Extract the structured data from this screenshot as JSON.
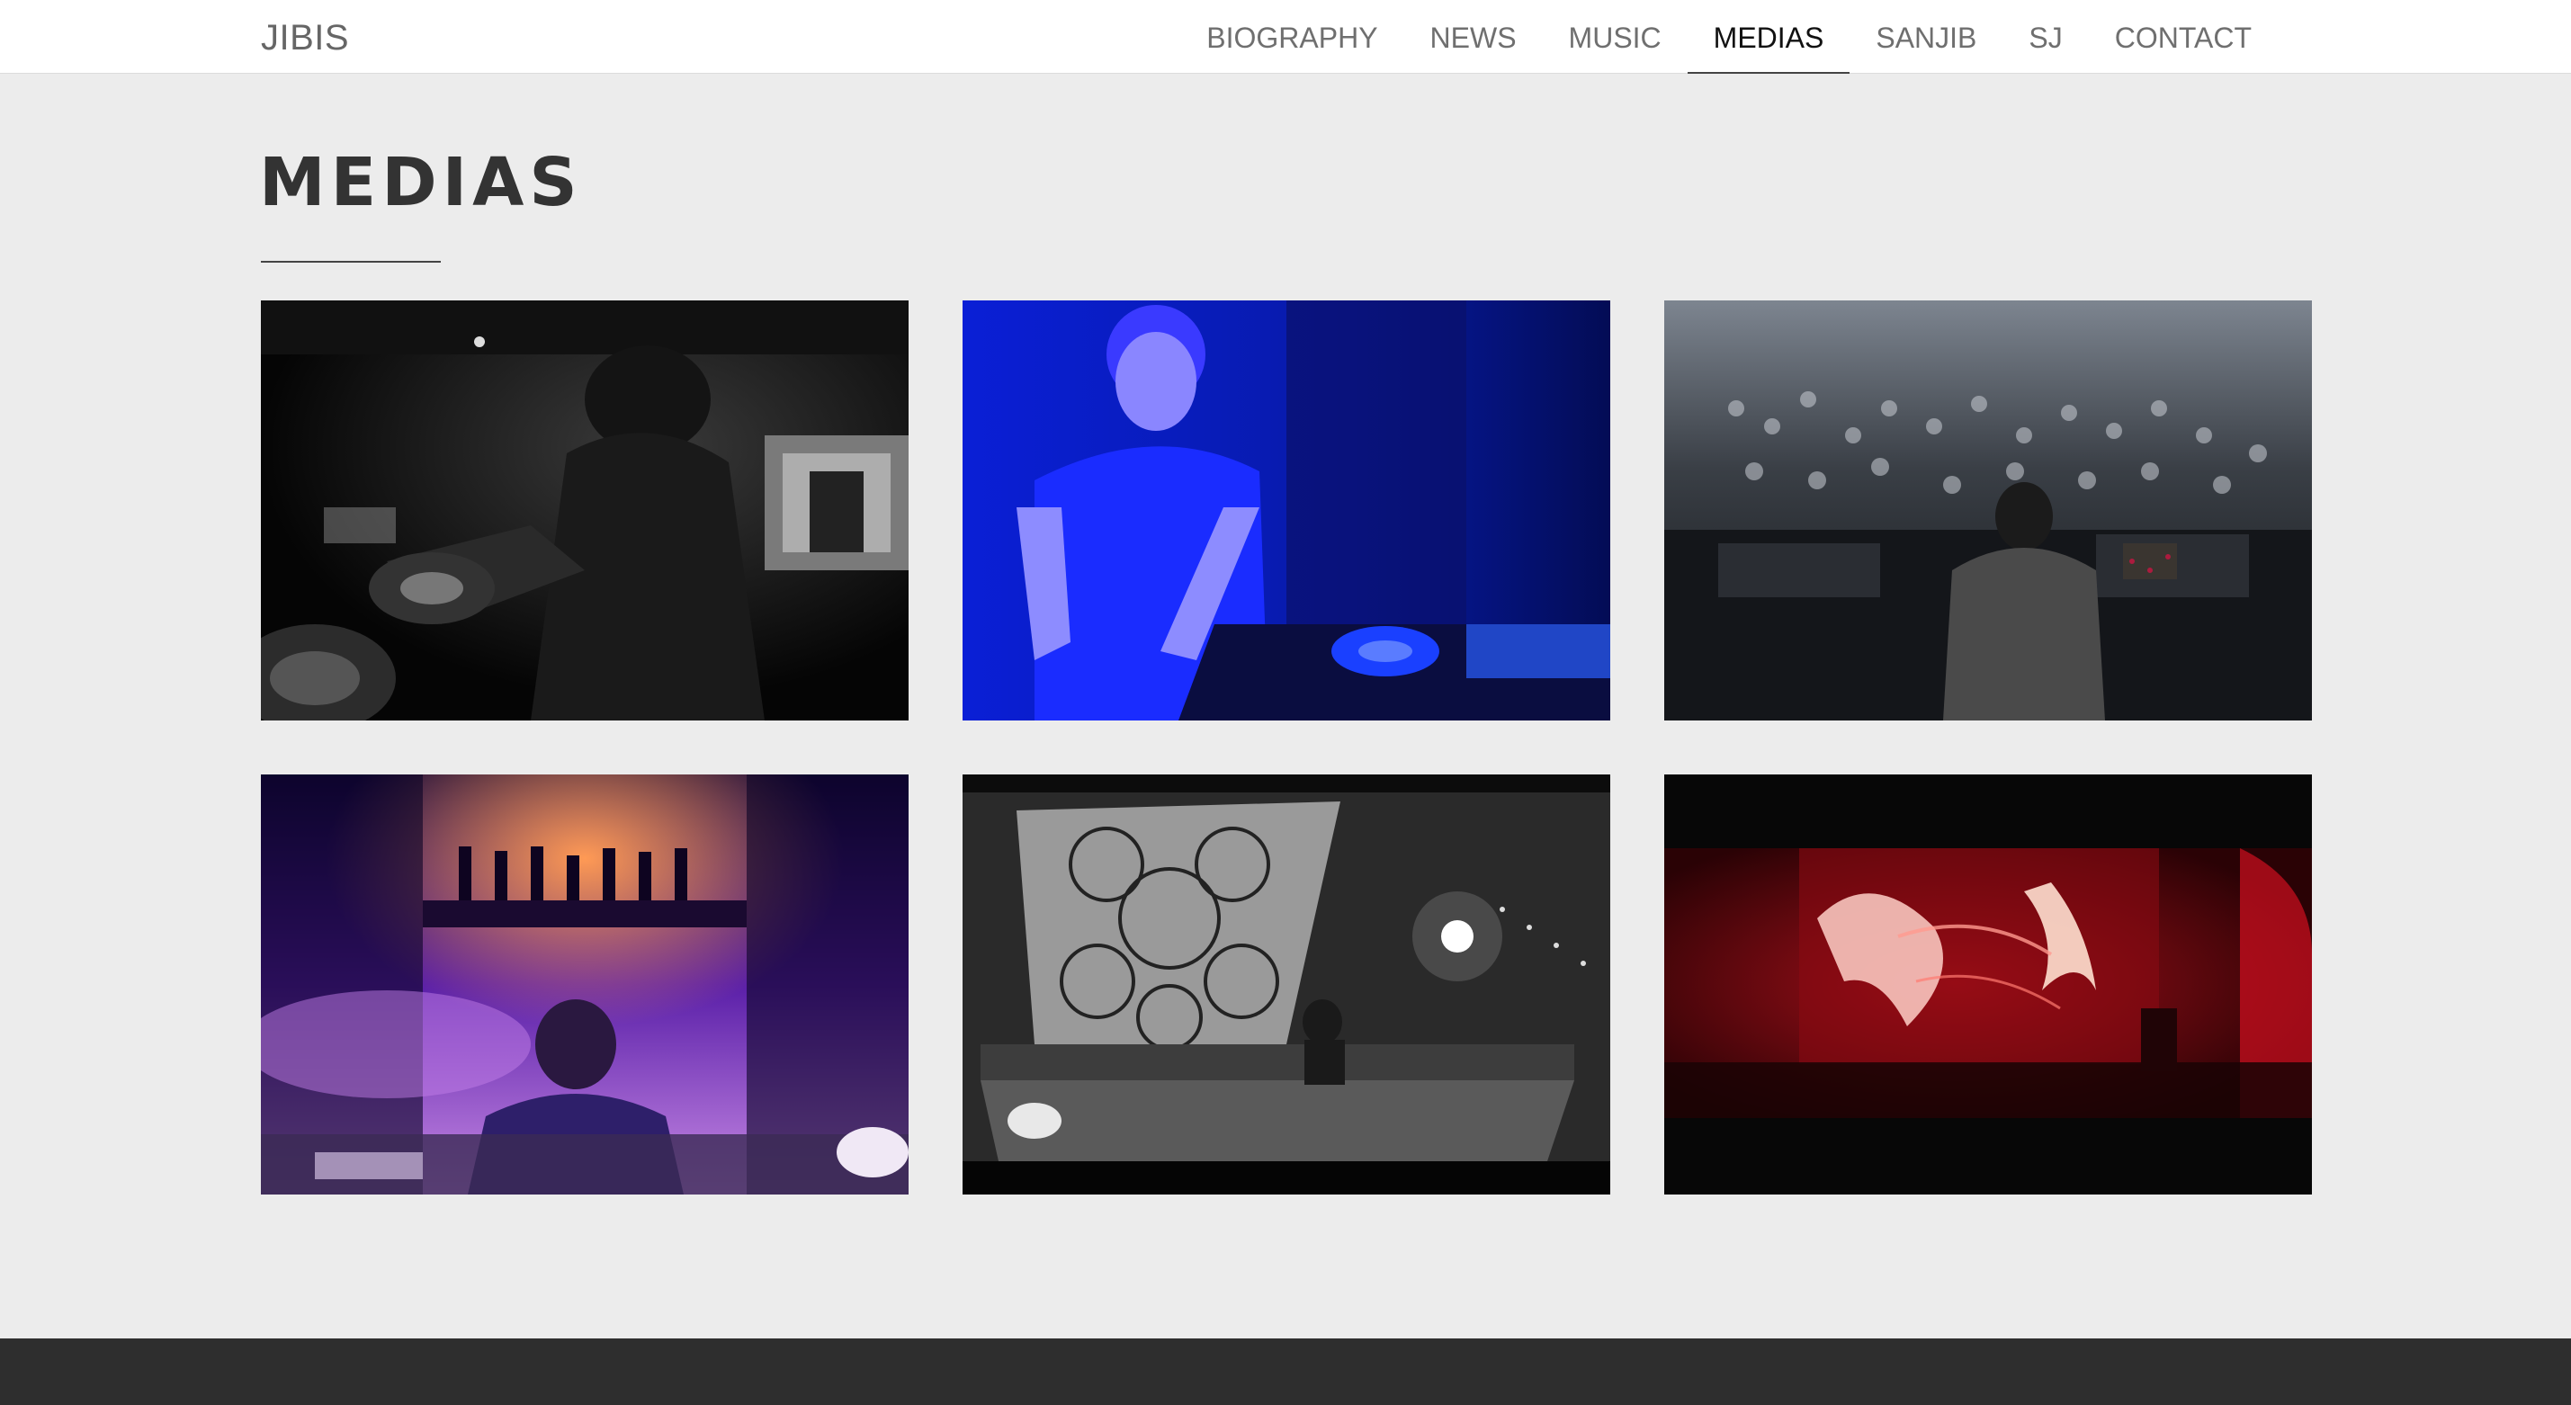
{
  "header": {
    "brand": "JIBIS",
    "nav": [
      {
        "label": "BIOGRAPHY",
        "active": false
      },
      {
        "label": "NEWS",
        "active": false
      },
      {
        "label": "MUSIC",
        "active": false
      },
      {
        "label": "MEDIAS",
        "active": true
      },
      {
        "label": "SANJIB",
        "active": false
      },
      {
        "label": "SJ",
        "active": false
      },
      {
        "label": "CONTACT",
        "active": false
      }
    ]
  },
  "main": {
    "title": "MEDIAS"
  },
  "colors": {
    "page_bg": "#ececec",
    "header_bg": "#ffffff",
    "footer_bg": "#2e2e2e",
    "title": "#333333",
    "nav_text": "#6f6f6f",
    "nav_active": "#111111"
  }
}
